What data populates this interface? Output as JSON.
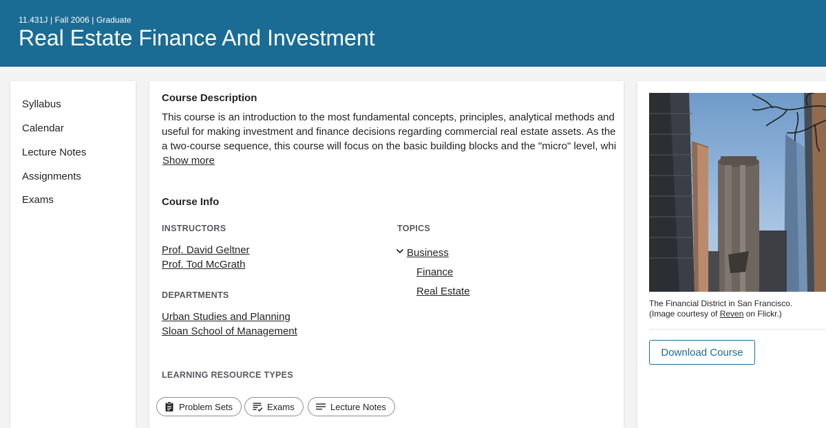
{
  "header": {
    "meta": "11.431J | Fall 2006 | Graduate",
    "title": "Real Estate Finance And Investment"
  },
  "nav": {
    "items": [
      {
        "label": "Syllabus"
      },
      {
        "label": "Calendar"
      },
      {
        "label": "Lecture Notes"
      },
      {
        "label": "Assignments"
      },
      {
        "label": "Exams"
      }
    ]
  },
  "description": {
    "heading": "Course Description",
    "lines": [
      "This course is an introduction to the most fundamental concepts, principles, analytical methods and tools",
      "useful for making investment and finance decisions regarding commercial real estate assets. As the first of",
      "a two-course sequence, this course will focus on the basic building blocks and the \"micro\" level, which …"
    ],
    "show_more": "Show more"
  },
  "course_info": {
    "heading": "Course Info",
    "instructors_label": "INSTRUCTORS",
    "instructors": [
      "Prof. David Geltner",
      "Prof. Tod McGrath"
    ],
    "departments_label": "DEPARTMENTS",
    "departments": [
      "Urban Studies and Planning",
      "Sloan School of Management"
    ],
    "topics_label": "TOPICS",
    "topic_parent": "Business",
    "topic_children": [
      "Finance",
      "Real Estate"
    ]
  },
  "resources": {
    "label": "LEARNING RESOURCE TYPES",
    "chips": [
      {
        "label": "Problem Sets",
        "icon": "clipboard-icon"
      },
      {
        "label": "Exams",
        "icon": "checklist-icon"
      },
      {
        "label": "Lecture Notes",
        "icon": "notes-icon"
      }
    ]
  },
  "sidebar": {
    "caption_line1": "The Financial District in San Francisco.",
    "caption_pre": "(Image courtesy of ",
    "caption_link": "Reven",
    "caption_post": " on Flickr.)",
    "download_label": "Download Course"
  },
  "colors": {
    "header_bg": "#1b6c94",
    "page_bg": "#f3f3f3",
    "accent": "#1b6c94"
  }
}
